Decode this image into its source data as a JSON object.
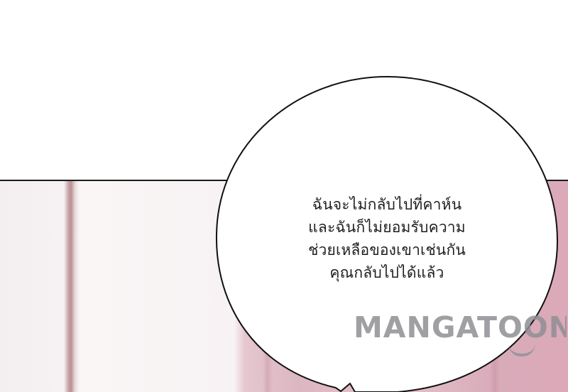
{
  "dialogue": {
    "lines": [
      "ฉันจะไม่กลับไปที่คาห์น",
      "และฉันก็ไม่ยอมรับความ",
      "ช่วยเหลือของเขาเช่นกัน",
      "คุณกลับไปได้แล้ว"
    ]
  },
  "watermark": {
    "text": "MANGATOON"
  },
  "colors": {
    "bubble_fill": "#ffffff",
    "bubble_outline": "#111111",
    "panel_divider": "#1a1a1a",
    "background_pink": "#dcb7c1",
    "watermark": "#8f8f95"
  }
}
